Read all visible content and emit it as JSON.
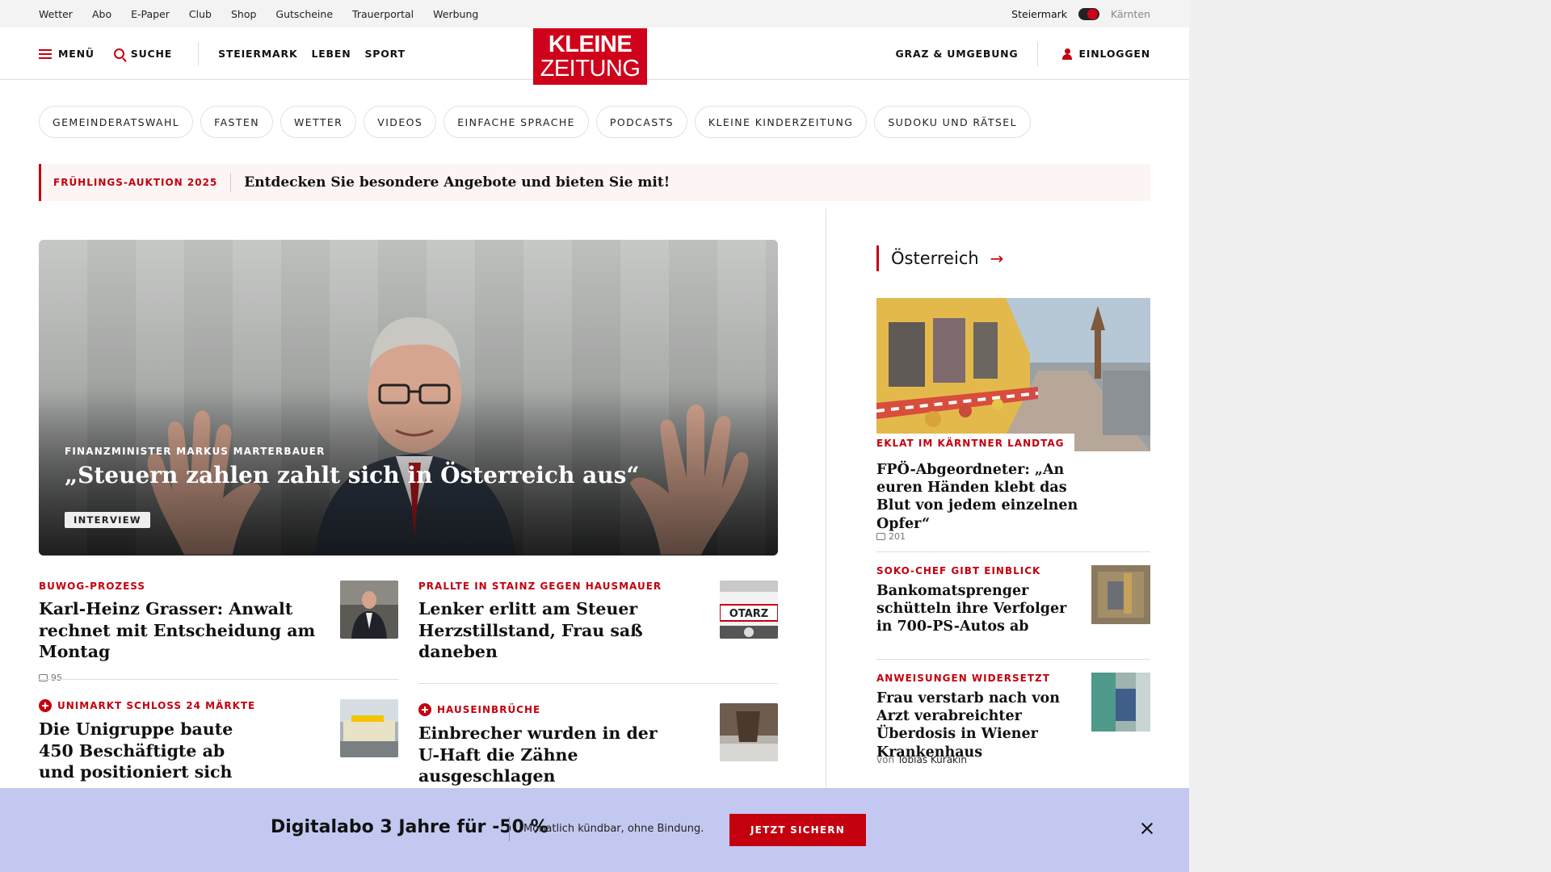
{
  "topbar": {
    "links": [
      "Wetter",
      "Abo",
      "E-Paper",
      "Club",
      "Shop",
      "Gutscheine",
      "Trauerportal",
      "Werbung"
    ],
    "region_active": "Steiermark",
    "region_inactive": "Kärnten"
  },
  "nav": {
    "menu": "MENÜ",
    "search": "SUCHE",
    "sections": [
      "STEIERMARK",
      "LEBEN",
      "SPORT"
    ],
    "location": "GRAZ & UMGEBUNG",
    "login": "EINLOGGEN"
  },
  "logo": {
    "line1": "KLEINE",
    "line2": "ZEITUNG",
    "color": "#d0021b"
  },
  "chips": [
    "GEMEINDERATSWAHL",
    "FASTEN",
    "WETTER",
    "VIDEOS",
    "EINFACHE SPRACHE",
    "PODCASTS",
    "KLEINE KINDERZEITUNG",
    "SUDOKU UND RÄTSEL"
  ],
  "promo": {
    "tag": "FRÜHLINGS-AUKTION 2025",
    "text": "Entdecken Sie besondere Angebote und bieten Sie mit!"
  },
  "hero": {
    "kicker": "FINANZMINISTER MARKUS MARTERBAUER",
    "title": "„Steuern zahlen zahlt sich in Österreich aus“",
    "badge": "INTERVIEW"
  },
  "teasers": [
    {
      "kicker": "BUWOG-PROZESS",
      "headline": "Karl-Heinz Grasser: Anwalt rechnet mit Entscheidung am Montag",
      "comments": "95",
      "plus": false
    },
    {
      "kicker": "PRALLTE IN STAINZ GEGEN HAUSMAUER",
      "headline": "Lenker erlitt am Steuer Herzstillstand, Frau saß daneben",
      "plus": false
    },
    {
      "kicker": "UNIMARKT SCHLOSS 24 MÄRKTE",
      "headline": "Die Unigruppe baute 450 Beschäftigte ab und positioniert sich neu",
      "plus": true
    },
    {
      "kicker": "HAUSEINBRÜCHE",
      "headline": "Einbrecher wurden in der U-Haft die Zähne ausgeschlagen",
      "plus": true
    }
  ],
  "sidebar": {
    "section": "Österreich",
    "arrow": "→",
    "items": [
      {
        "kicker": "EKLAT IM KÄRNTNER LANDTAG",
        "headline": "FPÖ-Abgeordneter: „An euren Händen klebt das Blut von jedem einzelnen Opfer“",
        "comments": "201"
      },
      {
        "kicker": "SOKO-CHEF GIBT EINBLICK",
        "headline": "Bankomatsprenger schütteln ihre Verfolger in 700-PS-Autos ab"
      },
      {
        "kicker": "ANWEISUNGEN WIDERSETZT",
        "headline": "Frau verstarb nach von Arzt verabreichter Überdosis in Wiener Krankenhaus",
        "author_prefix": "von",
        "author": "Tobias Kurakin"
      }
    ]
  },
  "banner": {
    "headline": "Digitalabo 3 Jahre für -50 %",
    "subtext": "Monatlich kündbar, ohne Bindung.",
    "cta": "JETZT SICHERN",
    "color": "#c3c8f0"
  },
  "colors": {
    "accent": "#c4000f"
  }
}
